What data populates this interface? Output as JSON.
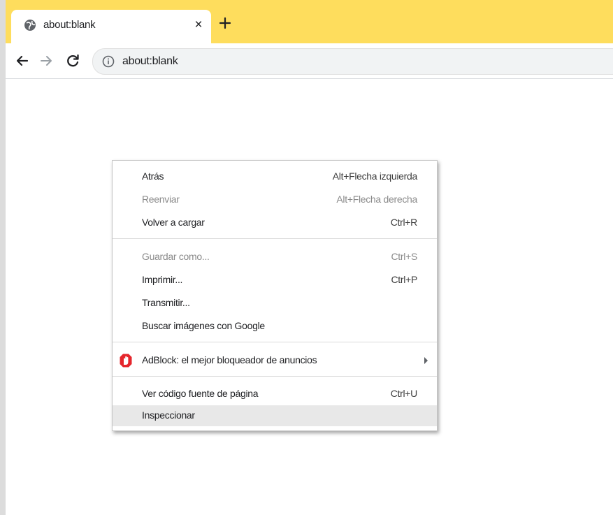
{
  "tab": {
    "title": "about:blank",
    "favicon": "globe-icon",
    "close_glyph": "×"
  },
  "toolbar": {
    "back": "back-arrow-icon",
    "forward": "forward-arrow-icon",
    "reload": "reload-icon",
    "info": "info-icon",
    "url": "about:blank"
  },
  "colors": {
    "tabstrip": "#fedd5d",
    "adblock_red": "#e5262c"
  },
  "context_menu": {
    "items": [
      {
        "label": "Atrás",
        "shortcut": "Alt+Flecha izquierda",
        "enabled": true
      },
      {
        "label": "Reenviar",
        "shortcut": "Alt+Flecha derecha",
        "enabled": false
      },
      {
        "label": "Volver a cargar",
        "shortcut": "Ctrl+R",
        "enabled": true
      },
      {
        "label": "Guardar como...",
        "shortcut": "Ctrl+S",
        "enabled": false
      },
      {
        "label": "Imprimir...",
        "shortcut": "Ctrl+P",
        "enabled": true
      },
      {
        "label": "Transmitir...",
        "shortcut": "",
        "enabled": true
      },
      {
        "label": "Buscar imágenes con Google",
        "shortcut": "",
        "enabled": true
      },
      {
        "label": "AdBlock: el mejor bloqueador de anuncios",
        "shortcut": "",
        "enabled": true,
        "icon": "adblock-icon",
        "has_submenu": true
      },
      {
        "label": "Ver código fuente de página",
        "shortcut": "Ctrl+U",
        "enabled": true
      },
      {
        "label": "Inspeccionar",
        "shortcut": "",
        "enabled": true,
        "highlighted": true
      }
    ]
  }
}
